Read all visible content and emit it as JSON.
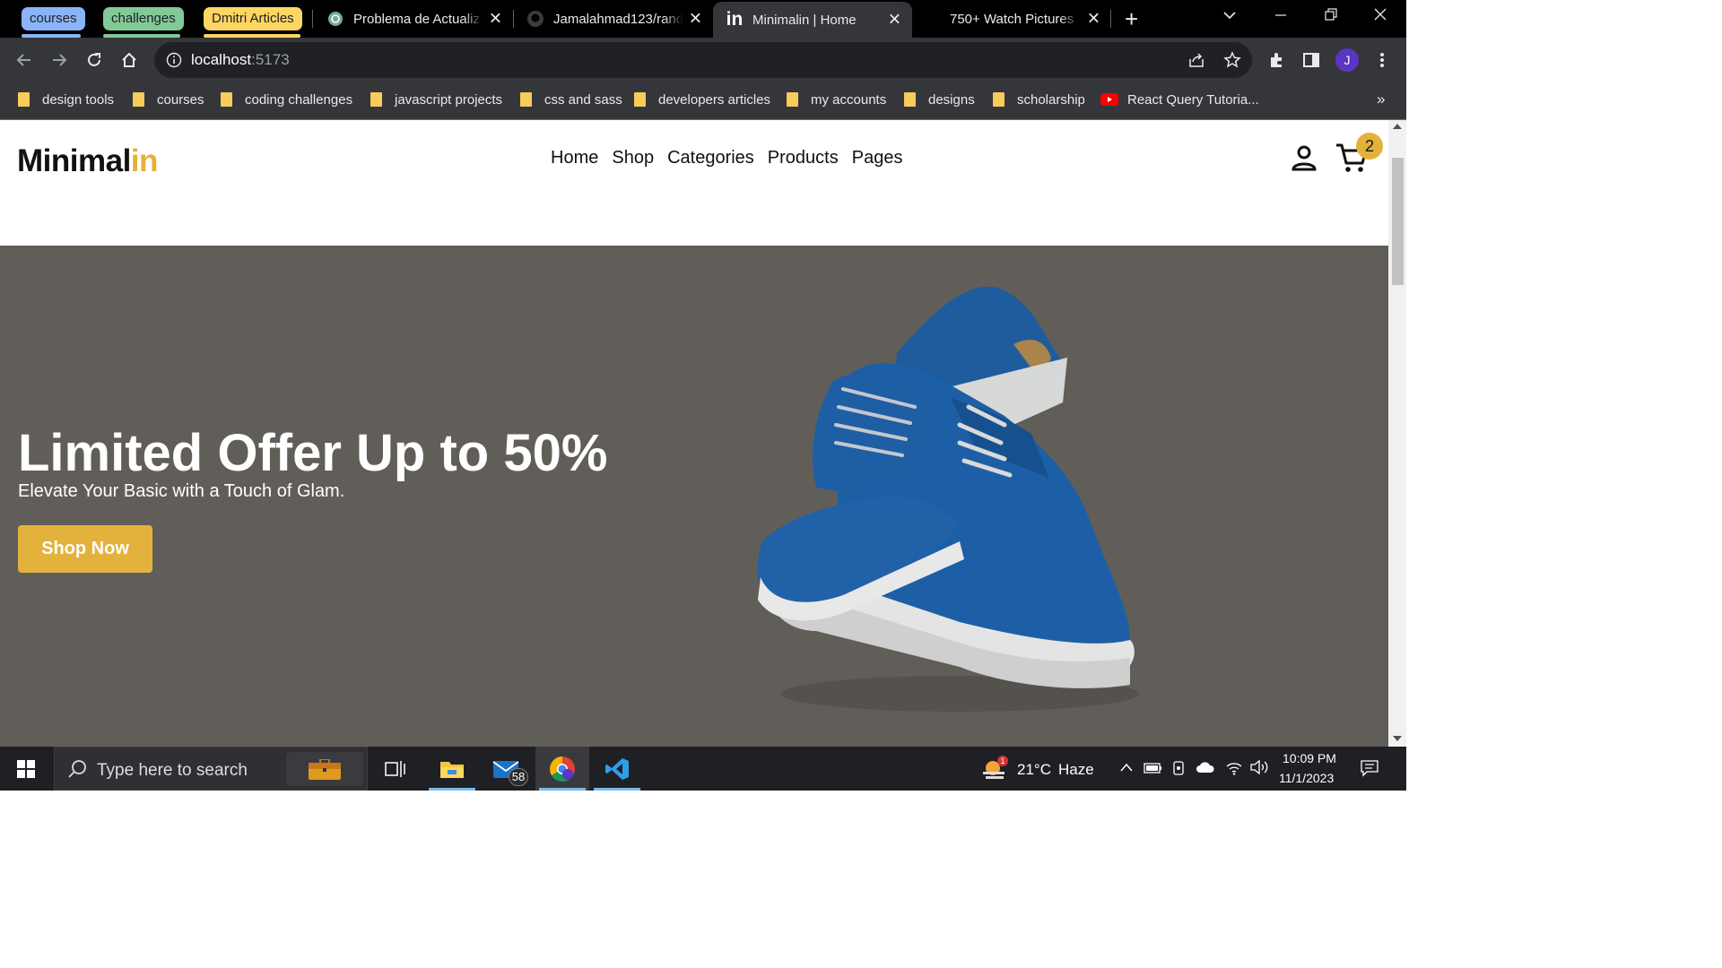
{
  "browser": {
    "tab_groups": [
      {
        "label": "courses",
        "color": "#8ab4f8"
      },
      {
        "label": "challenges",
        "color": "#81c995"
      },
      {
        "label": "Dmitri Articles",
        "color": "#fdd663"
      }
    ],
    "tabs": [
      {
        "title": "Problema de Actualiz",
        "icon": "openai-icon"
      },
      {
        "title": "Jamalahmad123/rand",
        "icon": "github-icon"
      },
      {
        "title": "Minimalin | Home",
        "icon": "linkedin-icon",
        "active": true
      },
      {
        "title": "750+ Watch Pictures",
        "icon": "blank-icon"
      }
    ],
    "new_tab": "+",
    "address": {
      "host": "localhost",
      "port": ":5173"
    },
    "profile_initial": "J",
    "bookmarks": [
      {
        "label": "design tools"
      },
      {
        "label": "courses"
      },
      {
        "label": "coding challenges"
      },
      {
        "label": "javascript projects"
      },
      {
        "label": "css and sass"
      },
      {
        "label": "developers articles"
      },
      {
        "label": "my accounts"
      },
      {
        "label": "designs"
      },
      {
        "label": "scholarship"
      },
      {
        "label": "React Query Tutoria...",
        "icon": "youtube-icon"
      }
    ],
    "bookmarks_overflow": "»"
  },
  "site": {
    "logo_main": "Minimal",
    "logo_accent": "in",
    "nav": [
      "Home",
      "Shop",
      "Categories",
      "Products",
      "Pages"
    ],
    "cart_count": "2",
    "hero": {
      "title": "Limited Offer Up to 50%",
      "subtitle": "Elevate Your Basic with a Touch of Glam.",
      "cta": "Shop Now",
      "image": "blue-suede-shoes"
    },
    "accent_color": "#e3b23c"
  },
  "taskbar": {
    "search_placeholder": "Type here to search",
    "mail_badge": "58",
    "weather": {
      "temp": "21°C",
      "condition": "Haze",
      "alert": "1"
    },
    "time": "10:09 PM",
    "date": "11/1/2023"
  }
}
